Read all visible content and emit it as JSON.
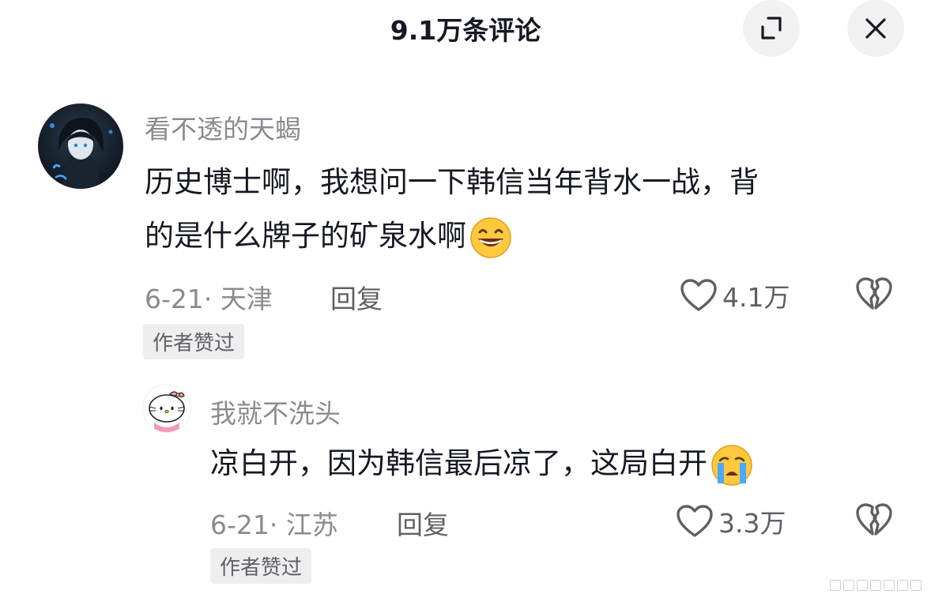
{
  "header": {
    "title": "9.1万条评论",
    "expand_icon": "expand-icon",
    "close_icon": "close-icon"
  },
  "comments": [
    {
      "username": "看不透的天蝎",
      "text_line1": "历史博士啊，我想问一下韩信当年背水一战，背",
      "text_line2": "的是什么牌子的矿泉水啊",
      "emoji": "grin-emoji",
      "meta": "6-21· 天津",
      "reply_label": "回复",
      "likes": "4.1万",
      "badge": "作者赞过"
    },
    {
      "username": "我就不洗头",
      "text": "凉白开，因为韩信最后凉了，这局白开",
      "emoji": "crying-emoji",
      "meta": "6-21· 江苏",
      "reply_label": "回复",
      "likes": "3.3万",
      "badge": "作者赞过"
    }
  ],
  "colors": {
    "text_primary": "#161823",
    "text_secondary": "#8a8b91",
    "badge_bg": "#eeeeef",
    "button_bg": "#f1f1f2"
  }
}
